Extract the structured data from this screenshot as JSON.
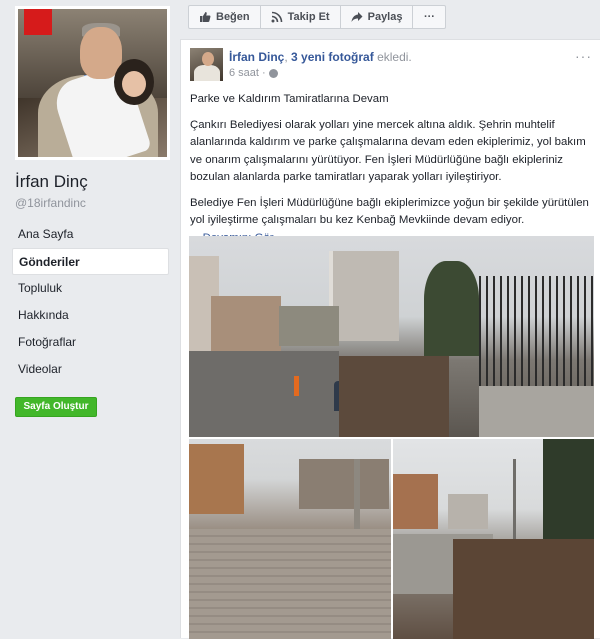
{
  "page": {
    "name": "İrfan Dinç",
    "handle": "@18irfandinc"
  },
  "nav": {
    "items": [
      {
        "label": "Ana Sayfa",
        "active": false
      },
      {
        "label": "Gönderiler",
        "active": true
      },
      {
        "label": "Topluluk",
        "active": false
      },
      {
        "label": "Hakkında",
        "active": false
      },
      {
        "label": "Fotoğraflar",
        "active": false
      },
      {
        "label": "Videolar",
        "active": false
      }
    ],
    "create_page_label": "Sayfa Oluştur"
  },
  "actions": {
    "like_label": "Beğen",
    "follow_label": "Takip Et",
    "share_label": "Paylaş",
    "more_label": "···"
  },
  "post": {
    "author": "İrfan Dinç",
    "separator": ",",
    "photo_count": "3 yeni fotoğraf",
    "action_text": "ekledi.",
    "time": "6 saat ·",
    "title": "Parke ve Kaldırım Tamiratlarına Devam",
    "paragraph1": "Çankırı Belediyesi olarak yolları yine mercek altına aldık. Şehrin muhtelif alanlarında kaldırım ve parke çalışmalarına devam eden ekiplerimiz, yol bakım ve onarım çalışmalarını yürütüyor. Fen İşleri Müdürlüğüne bağlı ekipleriniz bozulan alanlarda parke tamiratları yaparak yolları iyileştiriyor.",
    "paragraph2": "Belediye Fen İşleri Müdürlüğüne bağlı ekiplerimizce yoğun bir şekilde yürütülen yol iyileştirme çalışmaları bu kez Kenbağ Mevkiinde devam ediyor.",
    "see_more_prefix": "... ",
    "see_more": "Devamını Gör"
  },
  "colors": {
    "brand_blue": "#365899",
    "create_green": "#42b72a",
    "background": "#e9ebee"
  }
}
